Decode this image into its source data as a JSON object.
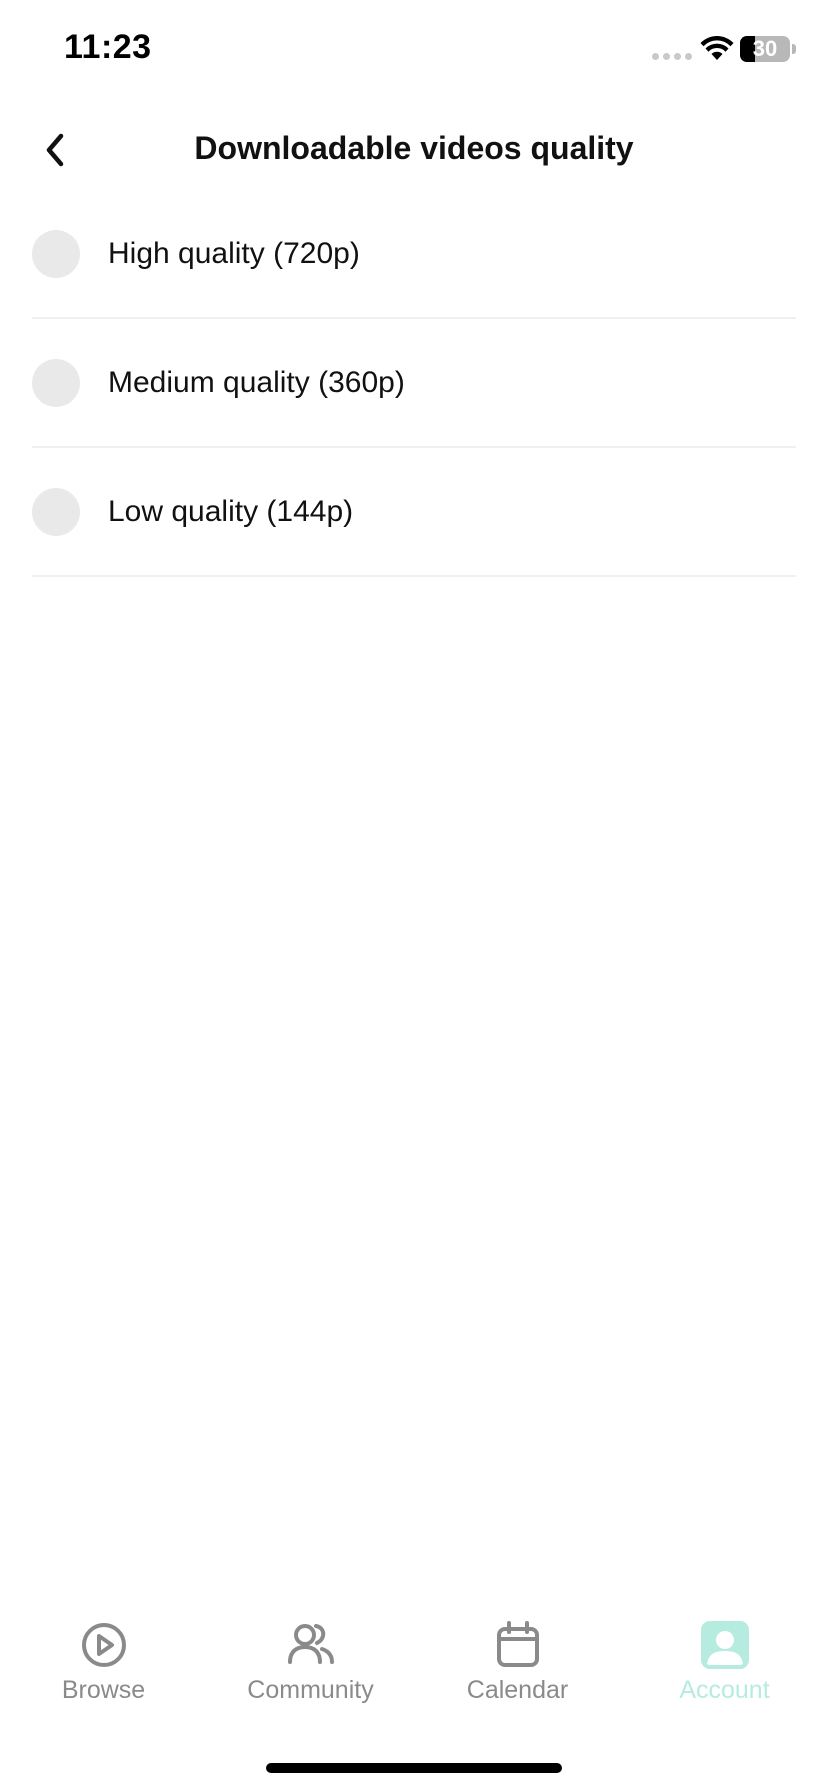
{
  "status_bar": {
    "time": "11:23",
    "battery_level": "30",
    "battery_fraction": 0.3
  },
  "header": {
    "title": "Downloadable videos quality",
    "back_icon": "chevron-left-icon"
  },
  "options": [
    {
      "label": "High quality (720p)",
      "selected": false
    },
    {
      "label": "Medium quality (360p)",
      "selected": false
    },
    {
      "label": "Low quality (144p)",
      "selected": false
    }
  ],
  "tab_bar": {
    "tabs": [
      {
        "label": "Browse",
        "icon": "play-circle-icon",
        "active": false
      },
      {
        "label": "Community",
        "icon": "users-icon",
        "active": false
      },
      {
        "label": "Calendar",
        "icon": "calendar-icon",
        "active": false
      },
      {
        "label": "Account",
        "icon": "account-icon",
        "active": true
      }
    ]
  },
  "colors": {
    "accent": "#b6ece0",
    "inactive": "#8a8a8a",
    "radio_fill": "#e9e9e9",
    "divider": "#f0f0f0"
  }
}
